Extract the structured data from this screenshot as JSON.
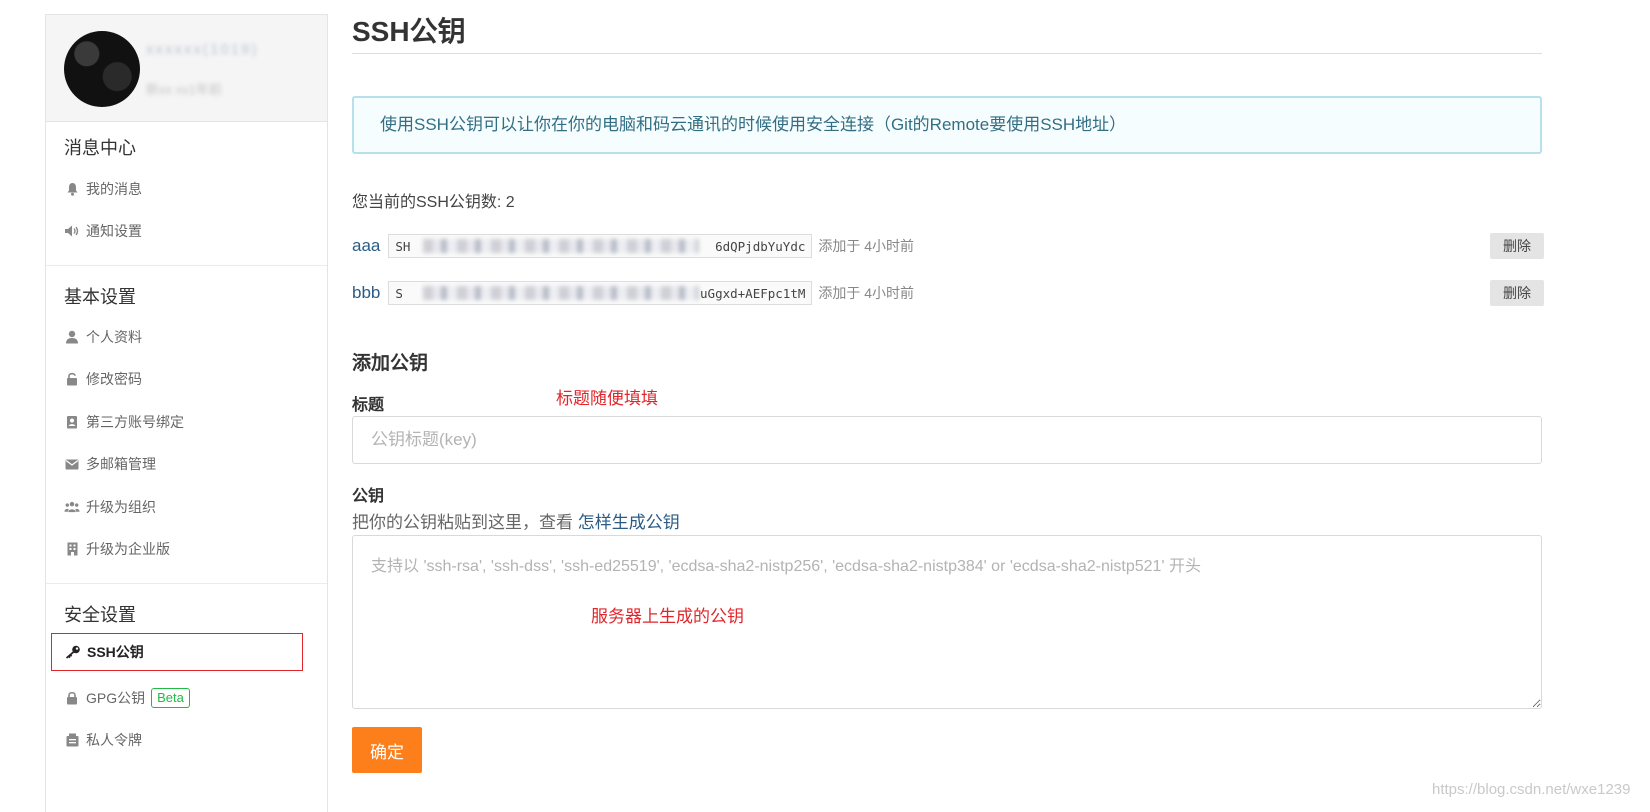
{
  "sidebar": {
    "profile": {
      "name": "xxxxxx(1019)",
      "meta": "新xx xx1年前"
    },
    "sections": [
      {
        "title": "消息中心",
        "items": [
          {
            "label": "我的消息",
            "icon": "bell-icon"
          },
          {
            "label": "通知设置",
            "icon": "speaker-icon"
          }
        ]
      },
      {
        "title": "基本设置",
        "items": [
          {
            "label": "个人资料",
            "icon": "user-icon"
          },
          {
            "label": "修改密码",
            "icon": "unlock-icon"
          },
          {
            "label": "第三方账号绑定",
            "icon": "contact-card-icon"
          },
          {
            "label": "多邮箱管理",
            "icon": "envelope-icon"
          },
          {
            "label": "升级为组织",
            "icon": "group-icon"
          },
          {
            "label": "升级为企业版",
            "icon": "building-icon"
          }
        ]
      },
      {
        "title": "安全设置",
        "items": [
          {
            "label": "SSH公钥",
            "icon": "key-icon",
            "active": true
          },
          {
            "label": "GPG公钥",
            "icon": "lock-icon",
            "badge": "Beta"
          },
          {
            "label": "私人令牌",
            "icon": "token-icon"
          }
        ]
      }
    ]
  },
  "main": {
    "page_title": "SSH公钥",
    "info": "使用SSH公钥可以让你在你的电脑和码云通讯的时候使用安全连接（Git的Remote要使用SSH地址）",
    "key_count": "您当前的SSH公钥数: 2",
    "keys": [
      {
        "name": "aaa",
        "fp_start": "SH",
        "fp_end": "6dQPjdbYuYdc",
        "added": "添加于 4小时前",
        "delete_label": "删除"
      },
      {
        "name": "bbb",
        "fp_start": "S",
        "fp_end": "uGgxd+AEFpc1tM",
        "added": "添加于 4小时前",
        "delete_label": "删除"
      }
    ],
    "add_title": "添加公钥",
    "title_field": {
      "label": "标题",
      "placeholder": "公钥标题(key)",
      "annotation": "标题随便填填"
    },
    "key_field": {
      "label": "公钥",
      "help": "把你的公钥粘贴到这里，查看",
      "help_link": "怎样生成公钥",
      "placeholder": "支持以 'ssh-rsa', 'ssh-dss', 'ssh-ed25519', 'ecdsa-sha2-nistp256', 'ecdsa-sha2-nistp384' or 'ecdsa-sha2-nistp521' 开头",
      "annotation": "服务器上生成的公钥"
    },
    "submit_label": "确定"
  },
  "watermark": "https://blog.csdn.net/wxe1239",
  "colors": {
    "accent": "#fd7f1c",
    "link": "#2b5c87",
    "annotation": "#e0262b",
    "beta": "#21ba45",
    "info_border": "#b7e0ea"
  }
}
